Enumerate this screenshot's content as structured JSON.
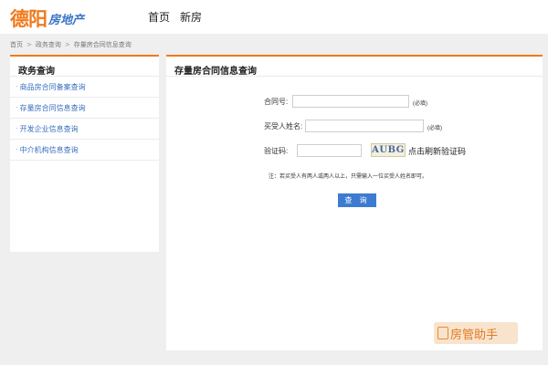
{
  "header": {
    "logo_main": "德阳",
    "logo_sub": "房地产",
    "nav": [
      "首页",
      "新房"
    ]
  },
  "breadcrumb": [
    "首页",
    "政务查询",
    "存量房合同信息查询"
  ],
  "sidebar": {
    "title": "政务查询",
    "items": [
      {
        "label": "商品房合同备案查询"
      },
      {
        "label": "存量房合同信息查询"
      },
      {
        "label": "开发企业信息查询"
      },
      {
        "label": "中介机构信息查询"
      }
    ]
  },
  "main": {
    "title": "存量房合同信息查询",
    "form": {
      "contract_label": "合同号:",
      "contract_value": "",
      "contract_required": "(必填)",
      "buyer_label": "买受人姓名:",
      "buyer_value": "",
      "buyer_required": "(必填)",
      "captcha_label": "验证码:",
      "captcha_value": "",
      "captcha_text": "AUBG",
      "captcha_refresh": "点击刷新验证码",
      "note": "注：若买受人有两人或两人以上，只需输入一位买受人姓名即可。",
      "submit": "查 询"
    }
  },
  "watermark": {
    "text": "房管助手"
  },
  "colors": {
    "accent": "#f07a1c",
    "link": "#3a6fbf",
    "button": "#3d7bd1"
  }
}
